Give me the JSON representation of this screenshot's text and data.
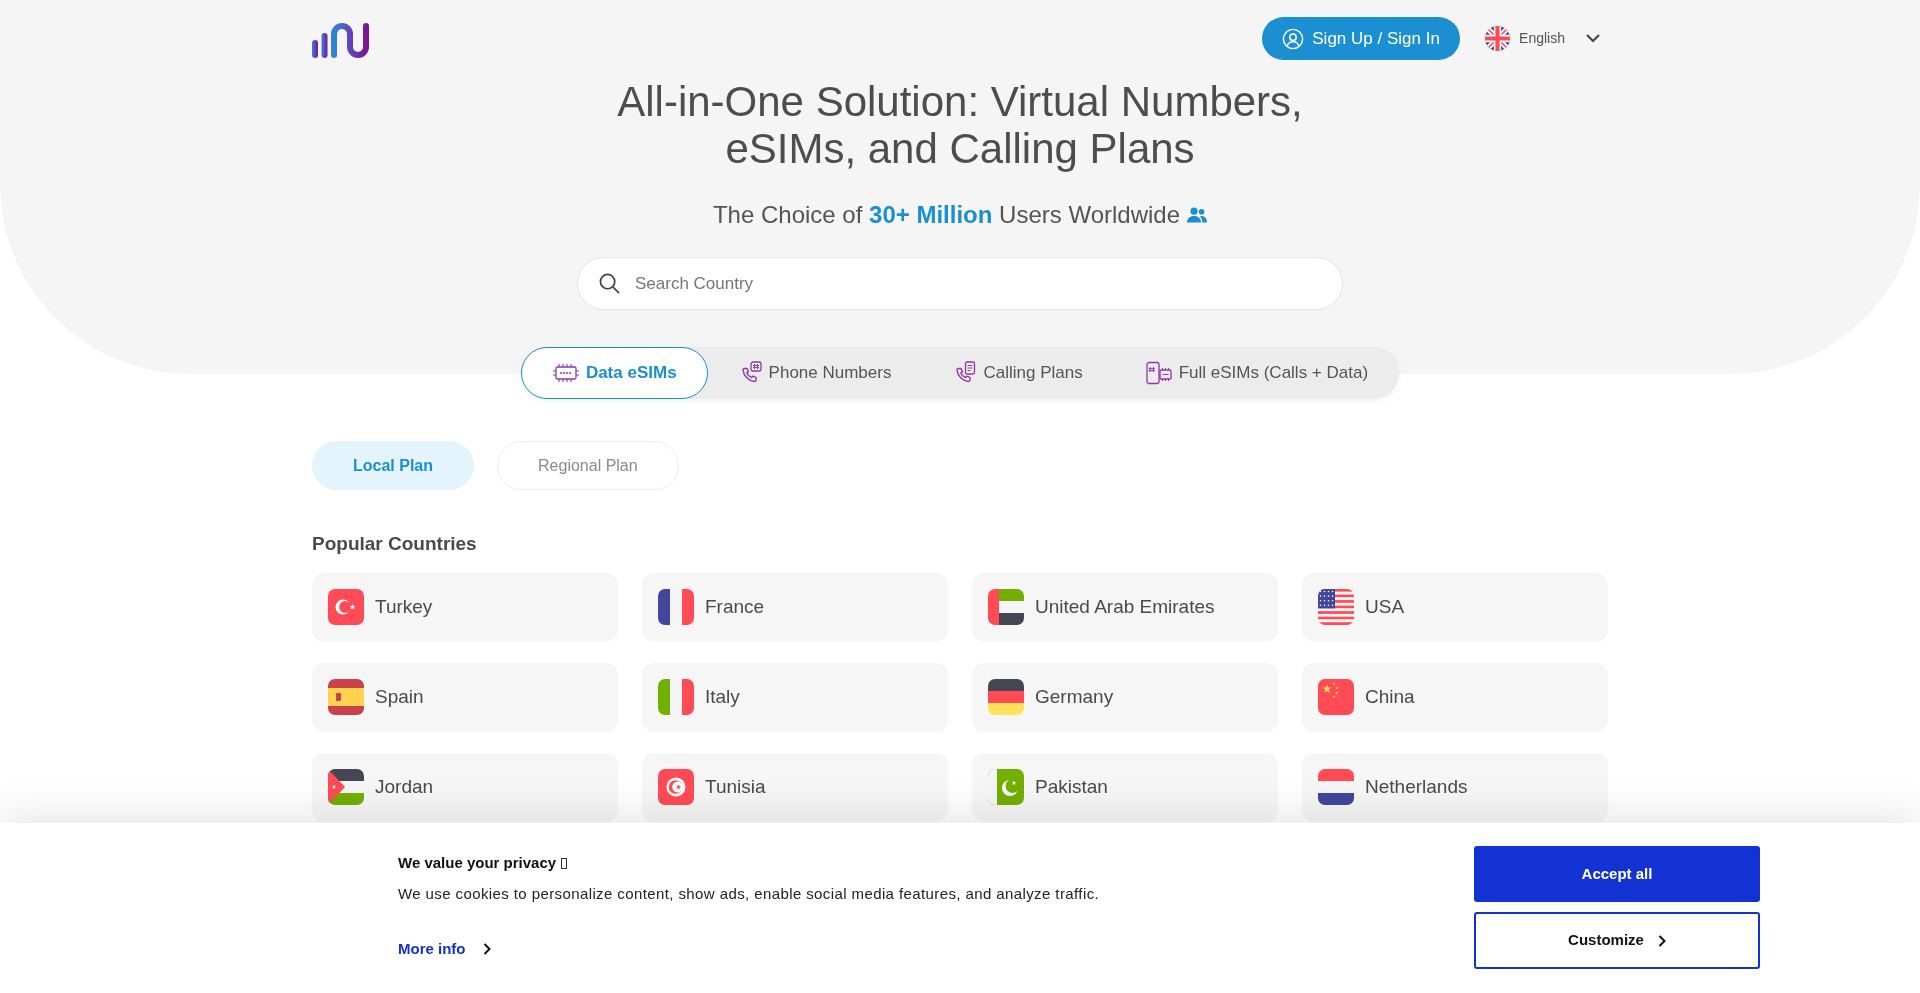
{
  "header": {
    "sign_in_button": "Sign Up / Sign In",
    "language": "English"
  },
  "hero": {
    "title": "All-in-One Solution: Virtual Numbers, eSIMs, and Calling Plans",
    "subtitle": "The Choice of **30+ Million** Users Worldwide",
    "search": {
      "placeholder": "Search Country"
    }
  },
  "product_tabs": [
    {
      "label": "Data eSIMs",
      "selected": true
    },
    {
      "label": "Phone Numbers",
      "selected": false
    },
    {
      "label": "Calling Plans",
      "selected": false
    },
    {
      "label": "Full eSIMs (Calls + Data)",
      "selected": false
    }
  ],
  "plan_types": [
    {
      "label": "Local Plan",
      "selected": true
    },
    {
      "label": "Regional Plan",
      "selected": false
    }
  ],
  "popular_countries": {
    "heading": "Popular Countries",
    "countries": [
      "Turkey",
      "France",
      "United Arab Emirates",
      "USA",
      "Spain",
      "Italy",
      "Germany",
      "China",
      "Jordan",
      "Tunisia",
      "Pakistan",
      "Netherlands"
    ]
  },
  "cookie_banner": {
    "title": "We value your privacy",
    "message": "We use cookies to personalize content, show ads, enable social media features, and analyze traffic.",
    "more_info_link": "More info",
    "buttons": [
      {
        "label": "Accept all",
        "kind": "primary"
      },
      {
        "label": "Customize",
        "kind": "secondary"
      }
    ]
  }
}
